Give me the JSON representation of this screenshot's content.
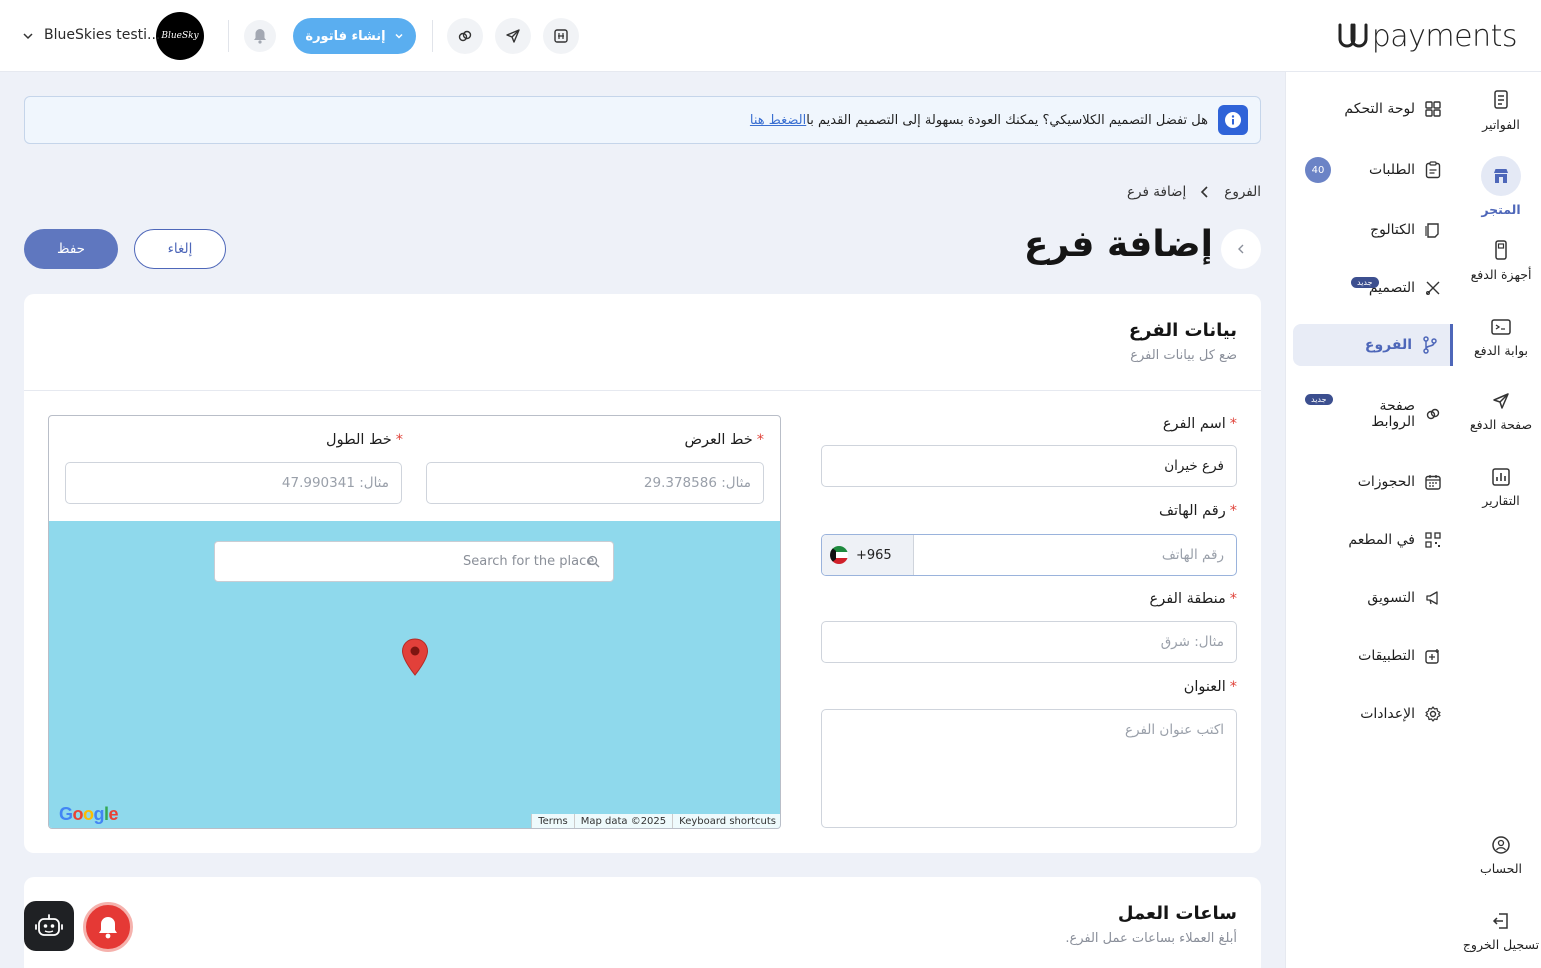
{
  "header": {
    "logo_text": "payments",
    "account_name": "BlueSkies testi...",
    "avatar_text": "BlueSky",
    "create_invoice_label": "إنشاء فاتورة"
  },
  "rail": {
    "items": [
      {
        "label": "الفواتير",
        "icon": "invoice-icon"
      },
      {
        "label": "المتجر",
        "icon": "store-icon",
        "active": true
      },
      {
        "label": "أجهزة الدفع",
        "icon": "pos-device-icon"
      },
      {
        "label": "بوابة الدفع",
        "icon": "gateway-icon"
      },
      {
        "label": "صفحة الدفع",
        "icon": "send-icon"
      },
      {
        "label": "التقارير",
        "icon": "reports-icon"
      },
      {
        "label": "الحساب",
        "icon": "account-icon"
      },
      {
        "label": "تسجيل الخروج",
        "icon": "logout-icon"
      }
    ]
  },
  "subnav": {
    "items": [
      {
        "label": "لوحة التحكم",
        "icon": "dashboard-icon"
      },
      {
        "label": "الطلبات",
        "icon": "orders-icon",
        "count": "40"
      },
      {
        "label": "الكتالوج",
        "icon": "catalog-icon"
      },
      {
        "label": "التصميم",
        "icon": "design-icon",
        "badge": "جديد"
      },
      {
        "label": "الفروع",
        "icon": "branch-icon",
        "active": true
      },
      {
        "label": "صفحة الروابط",
        "icon": "links-icon",
        "badge": "جديد"
      },
      {
        "label": "الحجوزات",
        "icon": "calendar-icon"
      },
      {
        "label": "في المطعم",
        "icon": "qr-icon"
      },
      {
        "label": "التسويق",
        "icon": "megaphone-icon"
      },
      {
        "label": "التطبيقات",
        "icon": "apps-icon"
      },
      {
        "label": "الإعدادات",
        "icon": "settings-icon"
      }
    ]
  },
  "notice": {
    "text": "هل تفضل التصميم الكلاسيكي؟ يمكنك العودة بسهولة إلى التصميم القديم با",
    "link": "الضغط هنا"
  },
  "breadcrumb": {
    "parent": "الفروع",
    "current": "إضافة فرع"
  },
  "page": {
    "title": "إضافة فرع",
    "save_label": "حفظ",
    "cancel_label": "إلغاء"
  },
  "branch_card": {
    "title": "بيانات الفرع",
    "subtitle": "ضع كل بيانات الفرع",
    "name_label": "اسم الفرع",
    "name_value": "فرع خيران",
    "phone_label": "رقم الهاتف",
    "phone_code": "+965",
    "phone_placeholder": "رقم الهاتف",
    "region_label": "منطقة الفرع",
    "region_placeholder": "مثال: شرق",
    "address_label": "العنوان",
    "address_placeholder": "اكتب عنوان الفرع",
    "lat_label": "خط العرض",
    "lat_placeholder": "مثال: 29.378586",
    "lng_label": "خط الطول",
    "lng_placeholder": "مثال: 47.990341",
    "map_search_placeholder": "Search for the place",
    "map_logo": "Google",
    "map_terms": "Terms",
    "map_data": "Map data ©2025",
    "map_shortcuts": "Keyboard shortcuts"
  },
  "hours_card": {
    "title": "ساعات العمل",
    "subtitle": "أبلغ العملاء بساعات عمل الفرع."
  },
  "colors": {
    "primary": "#5f77bf",
    "accent_blue": "#5aaef0",
    "map_water": "#8fd9ec",
    "required": "#e0433a"
  }
}
